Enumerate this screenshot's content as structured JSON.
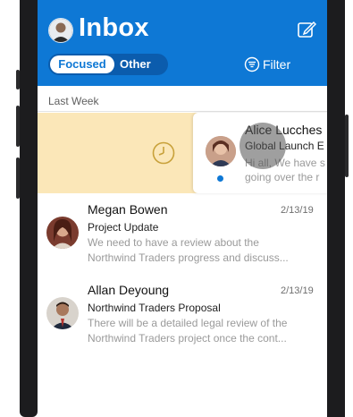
{
  "header": {
    "title": "Inbox",
    "tabs": {
      "focused": "Focused",
      "other": "Other"
    },
    "filter_label": "Filter",
    "accent": "#0e78d5"
  },
  "section": {
    "label": "Last Week"
  },
  "swiped_message": {
    "sender": "Alice Lucches",
    "subject": "Global Launch E",
    "preview_line1": "Hi all, We have s",
    "preview_line2": "going over the r",
    "action_icon": "clock-icon",
    "unread": true
  },
  "messages": [
    {
      "sender": "Megan Bowen",
      "date": "2/13/19",
      "subject": "Project Update",
      "preview_line1": "We need to have a review about the",
      "preview_line2": "Northwind Traders progress and discuss..."
    },
    {
      "sender": "Allan Deyoung",
      "date": "2/13/19",
      "subject": "Northwind Traders Proposal",
      "preview_line1": "There will be a detailed legal review of the",
      "preview_line2": "Northwind Traders project once the cont..."
    }
  ]
}
